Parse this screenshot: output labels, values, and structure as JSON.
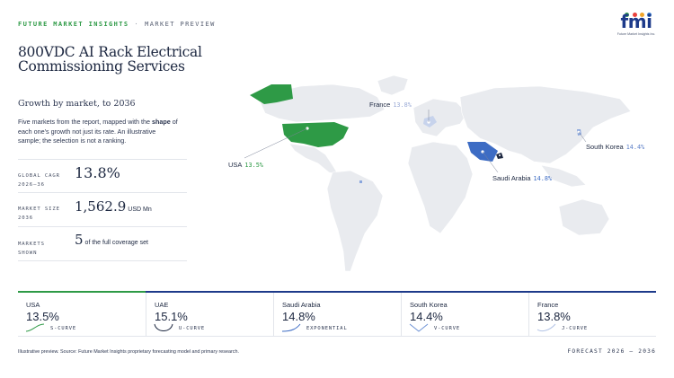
{
  "header": {
    "brand": "FUTURE MARKET INSIGHTS",
    "separator": "·",
    "section": "MARKET PREVIEW",
    "logo_text": "fmi",
    "logo_subtext": "Future Market Insights Inc."
  },
  "title": "800VDC AI Rack Electrical Commissioning Services",
  "subtitle": "Growth by market, to 2036",
  "description": {
    "before": "Five markets from the report, mapped with the ",
    "bold": "shape",
    "after": " of each one’s growth not just its rate. An illustrative sample; the selection is not a ranking."
  },
  "stats": [
    {
      "label": "GLOBAL CAGR 2026–36",
      "value": "13.8%",
      "unit": ""
    },
    {
      "label": "MARKET SIZE 2036",
      "value": "1,562.9",
      "unit": "USD Mn"
    },
    {
      "label": "MARKETS SHOWN",
      "value": "5",
      "unit": "of the full coverage set"
    }
  ],
  "map_markers": [
    {
      "country": "France",
      "cagr": "13.8%",
      "color": "#c7d3ec"
    },
    {
      "country": "South Korea",
      "cagr": "14.4%",
      "color": "#8aa6dc"
    },
    {
      "country": "USA",
      "cagr": "13.5%",
      "color": "#2e9a46"
    },
    {
      "country": "Saudi Arabia",
      "cagr": "14.8%",
      "color": "#3d6cc4"
    },
    {
      "country": "UAE",
      "cagr": "15.1%",
      "color": "#1c2740"
    }
  ],
  "cards": [
    {
      "country": "USA",
      "value": "13.5%",
      "curve": "S-CURVE",
      "color": "#2e9a46"
    },
    {
      "country": "UAE",
      "value": "15.1%",
      "curve": "U-CURVE",
      "color": "#1c2740"
    },
    {
      "country": "Saudi Arabia",
      "value": "14.8%",
      "curve": "EXPONENTIAL",
      "color": "#3d6cc4"
    },
    {
      "country": "South Korea",
      "value": "14.4%",
      "curve": "V-CURVE",
      "color": "#6f93d6"
    },
    {
      "country": "France",
      "value": "13.8%",
      "curve": "J-CURVE",
      "color": "#b3c4e6"
    }
  ],
  "footer": {
    "note": "Illustrative preview. Source: Future Market Insights proprietary forecasting model and primary research.",
    "forecast": "FORECAST 2026 – 2036"
  }
}
